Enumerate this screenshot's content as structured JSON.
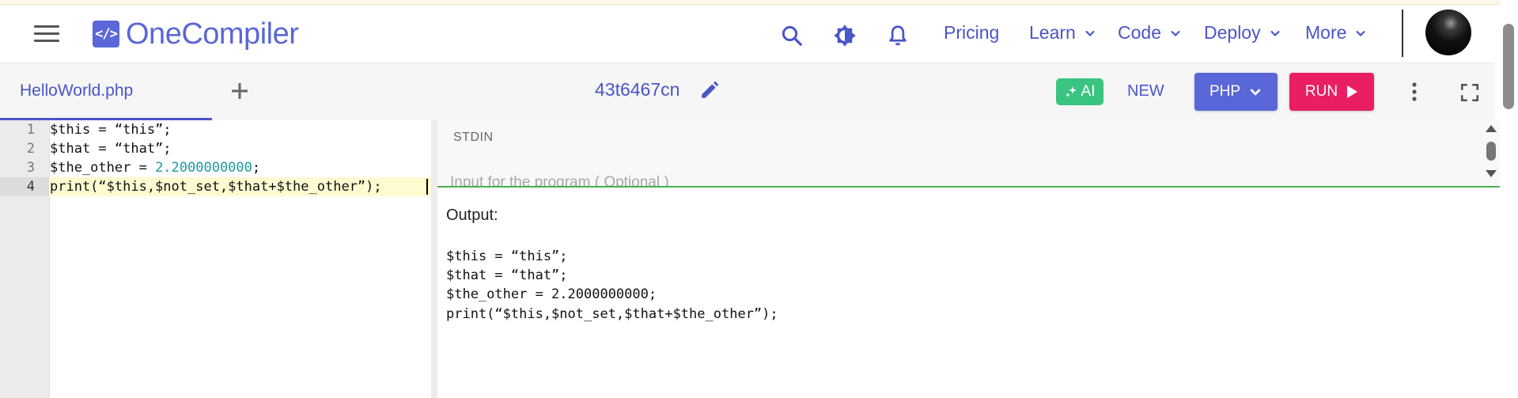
{
  "header": {
    "logo_symbol": "</>",
    "logo_text": "OneCompiler",
    "nav": [
      {
        "label": "Pricing"
      },
      {
        "label": "Learn"
      },
      {
        "label": "Code"
      },
      {
        "label": "Deploy"
      },
      {
        "label": "More"
      }
    ]
  },
  "toolbar": {
    "file_tab": "HelloWorld.php",
    "code_id": "43t6467cn",
    "ai_label": "AI",
    "new_label": "NEW",
    "language": "PHP",
    "run_label": "RUN"
  },
  "editor": {
    "lines": [
      {
        "num": "1",
        "code": "$this = “this”;"
      },
      {
        "num": "2",
        "code": "$that = “that”;"
      },
      {
        "num": "3",
        "code_pre": "$the_other = ",
        "code_num": "2.2000000000",
        "code_post": ";"
      },
      {
        "num": "4",
        "code": "print(“$this,$not_set,$that+$the_other”);"
      }
    ]
  },
  "stdin": {
    "label": "STDIN",
    "placeholder": "Input for the program ( Optional )"
  },
  "output": {
    "label": "Output:",
    "lines": [
      "$this = “this”;",
      "$that = “that”;",
      "$the_other = 2.2000000000;",
      "print(“$this,$not_set,$that+$the_other”);"
    ]
  },
  "colors": {
    "brand": "#5a67d8",
    "link": "#4a55c8",
    "run": "#e91e63",
    "ai": "#3ac481",
    "number": "#1a9aa0"
  },
  "icons": [
    "hamburger-icon",
    "search-icon",
    "theme-toggle-icon",
    "bell-icon",
    "chevron-down-icon",
    "plus-icon",
    "pencil-icon",
    "sparkle-icon",
    "play-icon",
    "more-vertical-icon",
    "fullscreen-icon"
  ]
}
